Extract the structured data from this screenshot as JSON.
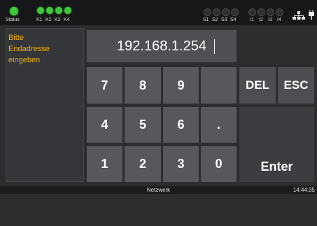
{
  "statusbar": {
    "status_label": "Status",
    "k_labels": [
      "K1",
      "K2",
      "K3",
      "K4"
    ],
    "s_labels": [
      "S1",
      "S2",
      "S3",
      "S4"
    ],
    "i_labels": [
      "I1",
      "I2",
      "I3",
      "I4"
    ],
    "status_led": "on",
    "k_leds": [
      "on",
      "on",
      "on",
      "on"
    ],
    "s_leds": [
      "off",
      "off",
      "off",
      "off"
    ],
    "i_leds": [
      "off",
      "off",
      "off",
      "off"
    ],
    "icons": [
      "network-icon",
      "plug-icon"
    ],
    "colors": {
      "led_on": "#3fc83c",
      "led_off": "#2c2e30"
    }
  },
  "prompt": {
    "line1": "Bitte",
    "line2": "Endadresse",
    "line3": "eingeben",
    "color": "#f0b400"
  },
  "display": {
    "value": "192.168.1.254"
  },
  "keypad": {
    "k7": "7",
    "k8": "8",
    "k9": "9",
    "k4": "4",
    "k5": "5",
    "k6": "6",
    "kdot": ".",
    "k1": "1",
    "k2": "2",
    "k3": "3",
    "k0": "0",
    "del": "DEL",
    "esc": "ESC",
    "enter": "Enter"
  },
  "footer": {
    "title": "Netzwerk",
    "time": "14:44:35"
  }
}
